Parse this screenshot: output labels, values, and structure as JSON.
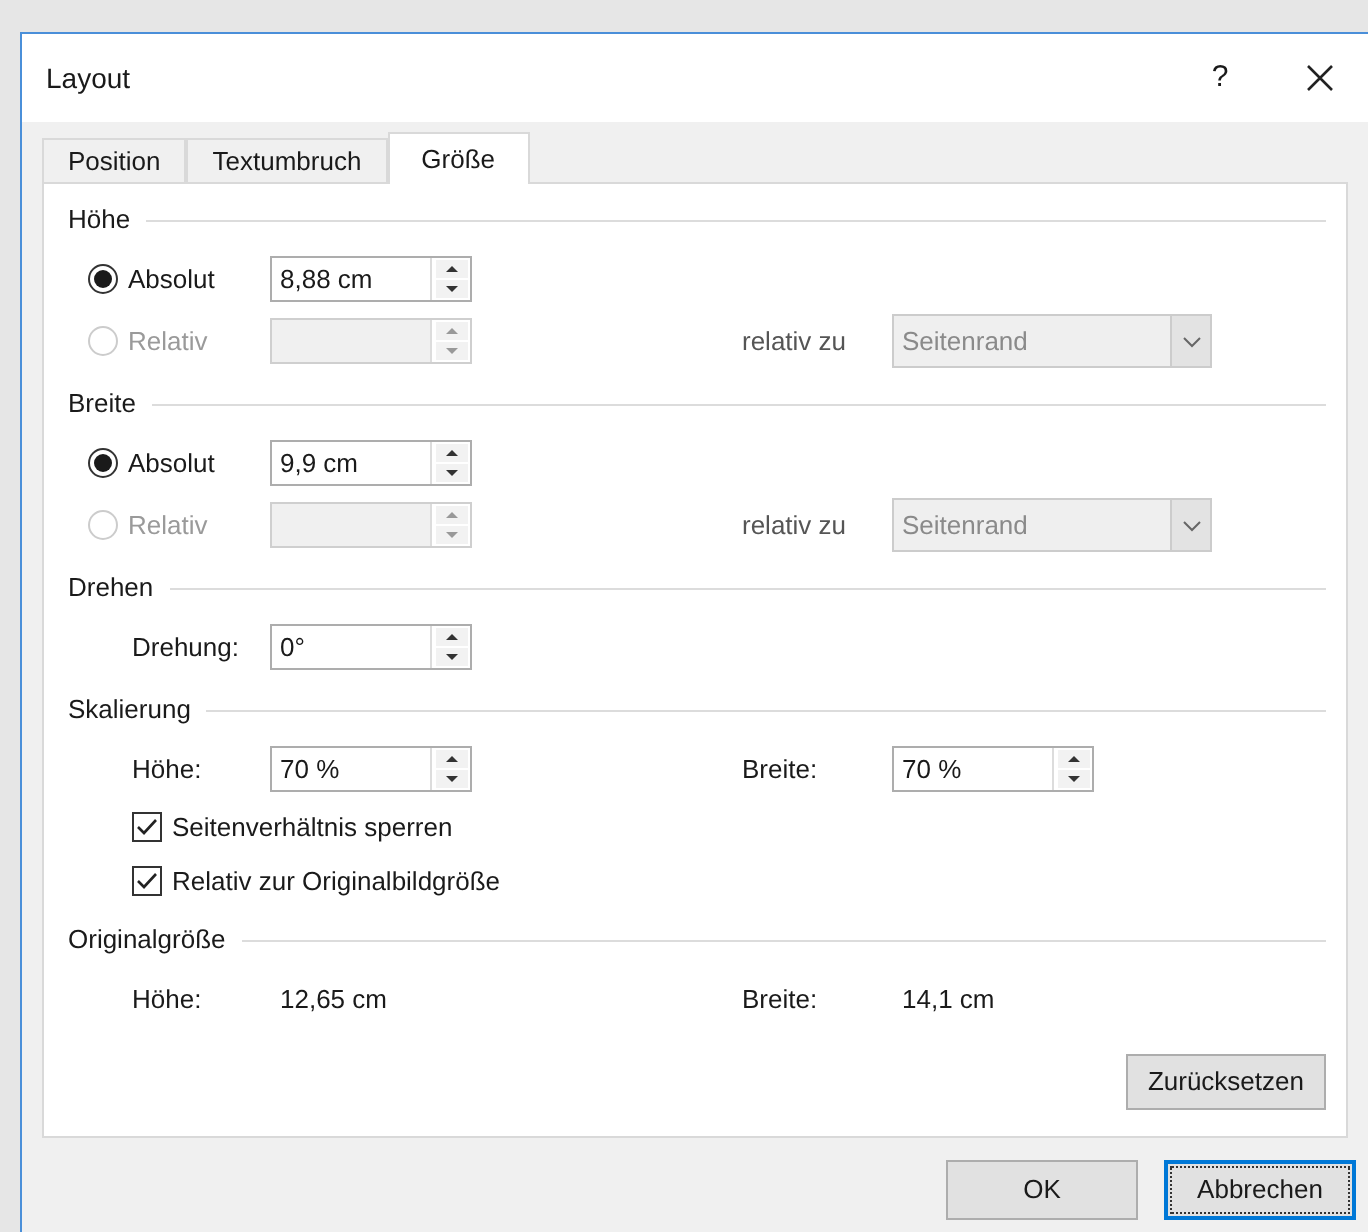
{
  "window": {
    "title": "Layout",
    "help": "?"
  },
  "tabs": [
    {
      "label": "Position",
      "selected": false
    },
    {
      "label": "Textumbruch",
      "selected": false
    },
    {
      "label": "Größe",
      "selected": true
    }
  ],
  "sections": [
    {
      "title": "Höhe",
      "rows": [
        {
          "kind": "radio",
          "label": "Absolut",
          "selected": true,
          "disabled": false,
          "value": "8,88 cm"
        },
        {
          "kind": "radio",
          "label": "Relativ",
          "selected": false,
          "disabled": true,
          "relative_label": "relativ zu",
          "relative_value": "Seitenrand"
        }
      ]
    },
    {
      "title": "Breite",
      "rows": [
        {
          "kind": "radio",
          "label": "Absolut",
          "selected": true,
          "disabled": false,
          "value": "9,9 cm"
        },
        {
          "kind": "radio",
          "label": "Relativ",
          "selected": false,
          "disabled": true,
          "relative_label": "relativ zu",
          "relative_value": "Seitenrand"
        }
      ]
    },
    {
      "title": "Drehen",
      "rows": [
        {
          "kind": "spin",
          "label": "Drehung:",
          "value": "0°"
        }
      ]
    },
    {
      "title": "Skalierung",
      "rows": [
        {
          "kind": "spin",
          "label": "Höhe:",
          "value": "70 %",
          "label2": "Breite:",
          "value2": "70 %"
        },
        {
          "kind": "checkbox",
          "label": "Seitenverhältnis sperren",
          "checked": true
        },
        {
          "kind": "checkbox",
          "label": "Relativ zur Originalbildgröße",
          "checked": true
        }
      ]
    },
    {
      "title": "Originalgröße",
      "rows": [
        {
          "kind": "info",
          "label": "Höhe:",
          "value": "12,65 cm",
          "label2": "Breite:",
          "value2": "14,1 cm"
        }
      ]
    }
  ],
  "reset_button": "Zurücksetzen",
  "buttons": [
    {
      "label": "OK",
      "focused": false
    },
    {
      "label": "Abbrechen",
      "focused": true
    }
  ]
}
